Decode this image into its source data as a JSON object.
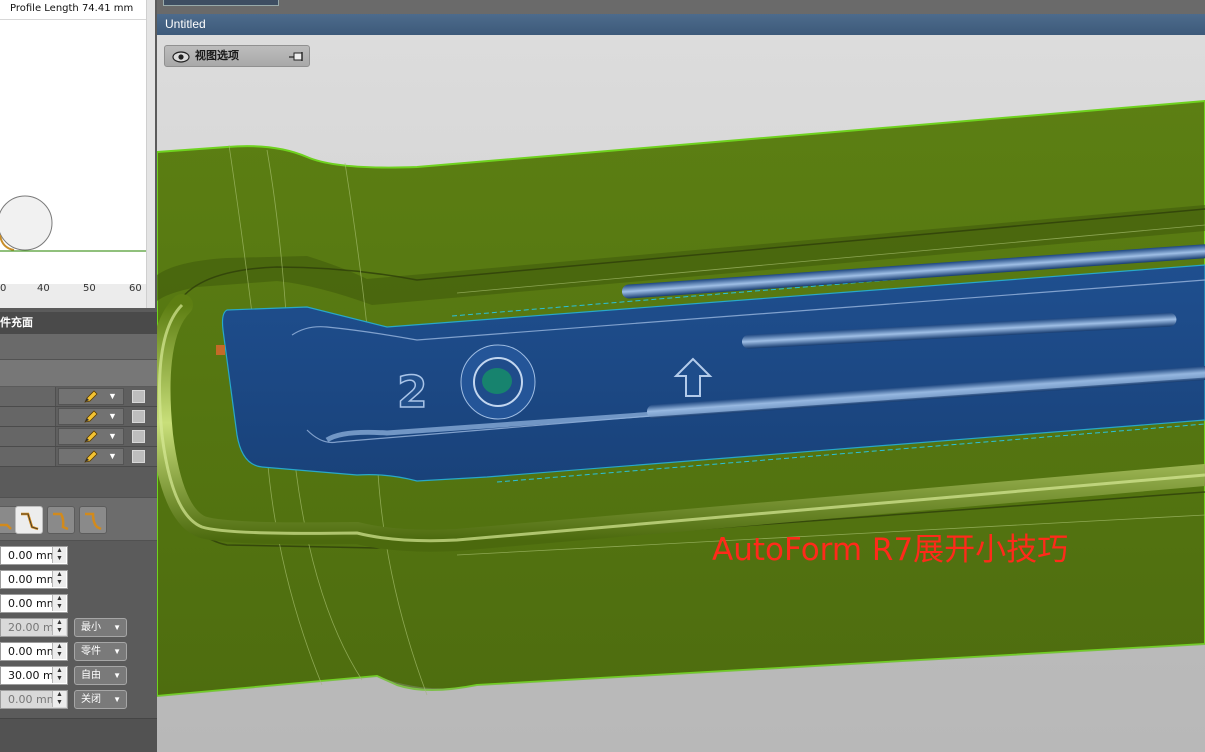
{
  "profile": {
    "header": "Profile Length 74.41 mm",
    "ticks": [
      "0",
      "40",
      "50",
      "60"
    ]
  },
  "panel": {
    "section_title": "件充面",
    "rows": 4,
    "fields": [
      {
        "value": "0.00 mm",
        "dim": false,
        "combo": ""
      },
      {
        "value": "0.00 mm",
        "dim": false,
        "combo": ""
      },
      {
        "value": "0.00 mm",
        "dim": false,
        "combo": ""
      },
      {
        "value": "20.00 mm",
        "dim": true,
        "combo": "最小"
      },
      {
        "value": "0.00 mm",
        "dim": false,
        "combo": "零件"
      },
      {
        "value": "30.00 mm",
        "dim": false,
        "combo": "自由"
      },
      {
        "value": "0.00 mm",
        "dim": true,
        "combo": "关闭"
      }
    ]
  },
  "viewport": {
    "title": "Untitled",
    "view_options_label": "视图选项",
    "part_number": "2",
    "watermark": "AutoForm R7展开小技巧"
  },
  "colors": {
    "green": "#5a7d13",
    "blue": "#1d4a87",
    "bead": "#86a833",
    "accent": "#ff2a1a"
  }
}
